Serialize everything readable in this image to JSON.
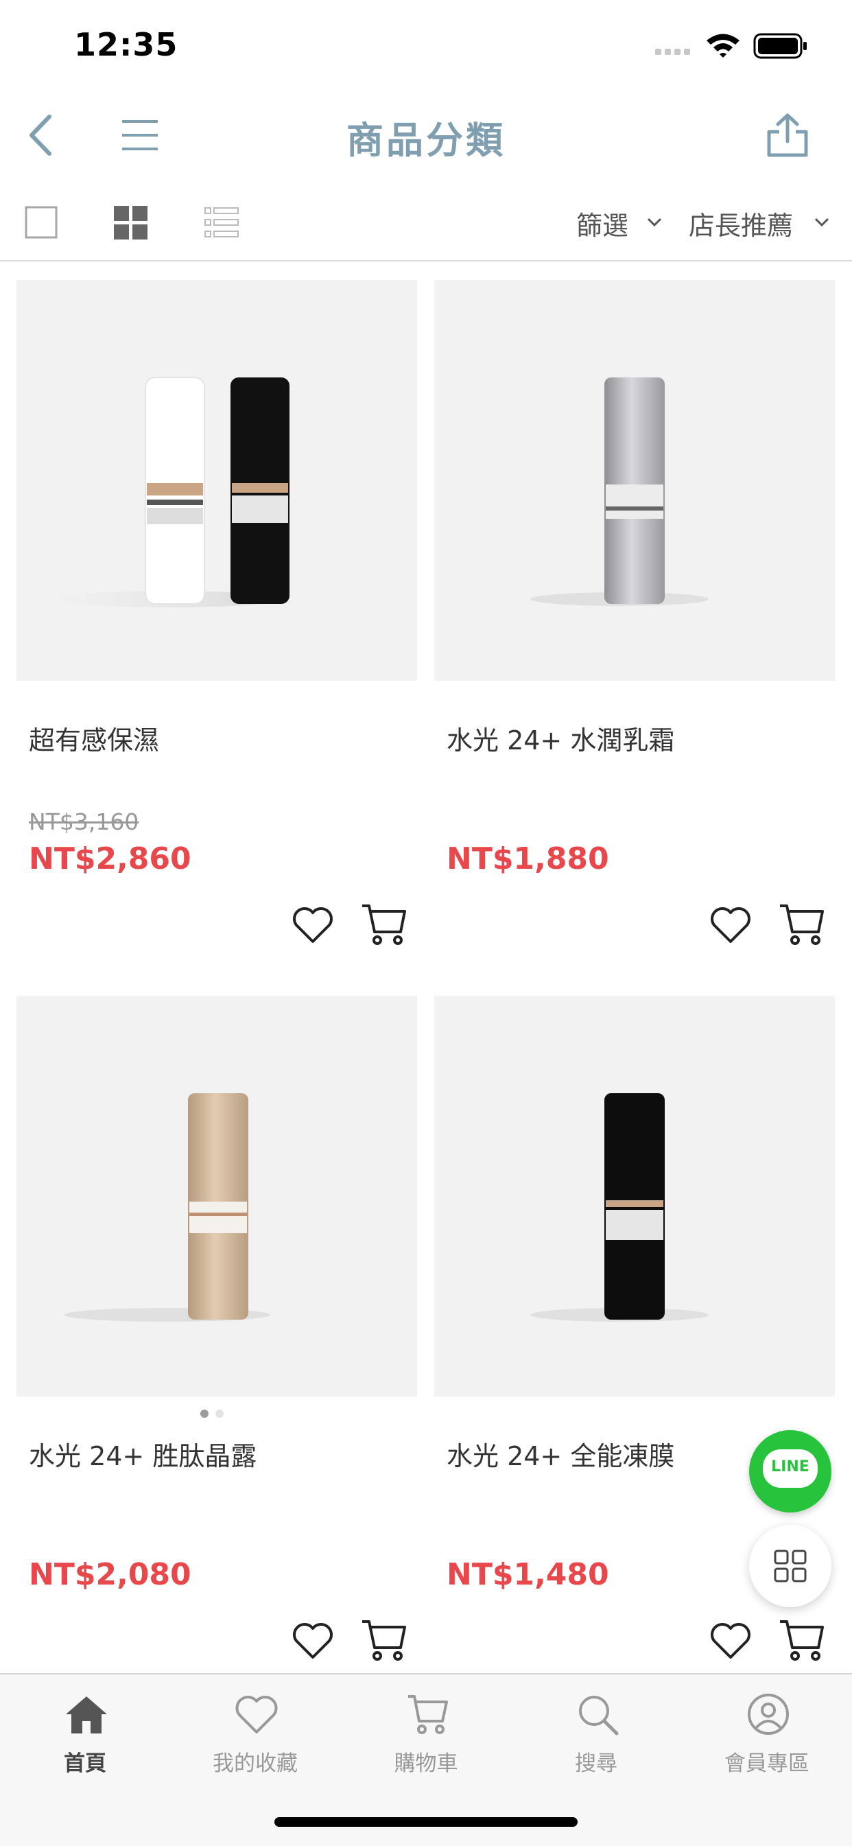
{
  "status_bar": {
    "time": "12:35"
  },
  "nav": {
    "title": "商品分類"
  },
  "toolbar": {
    "filter_label": "篩選",
    "sort_label": "店長推薦"
  },
  "products": [
    {
      "name": "超有感保濕",
      "old_price": "NT$3,160",
      "price": "NT$2,860"
    },
    {
      "name": "水光 24+ 水潤乳霜",
      "price": "NT$1,880"
    },
    {
      "name": "水光 24+ 胜肽晶露",
      "price": "NT$2,080"
    },
    {
      "name": "水光 24+ 全能凍膜",
      "price": "NT$1,480"
    }
  ],
  "floating": {
    "line_label": "LINE"
  },
  "tabbar": {
    "items": [
      {
        "label": "首頁",
        "icon": "home-icon",
        "active": true
      },
      {
        "label": "我的收藏",
        "icon": "heart-icon"
      },
      {
        "label": "購物車",
        "icon": "cart-icon"
      },
      {
        "label": "搜尋",
        "icon": "search-icon"
      },
      {
        "label": "會員專區",
        "icon": "user-icon"
      }
    ]
  },
  "colors": {
    "price": "#e8484b",
    "title": "#7f9fb0",
    "line_green": "#28c33c"
  }
}
